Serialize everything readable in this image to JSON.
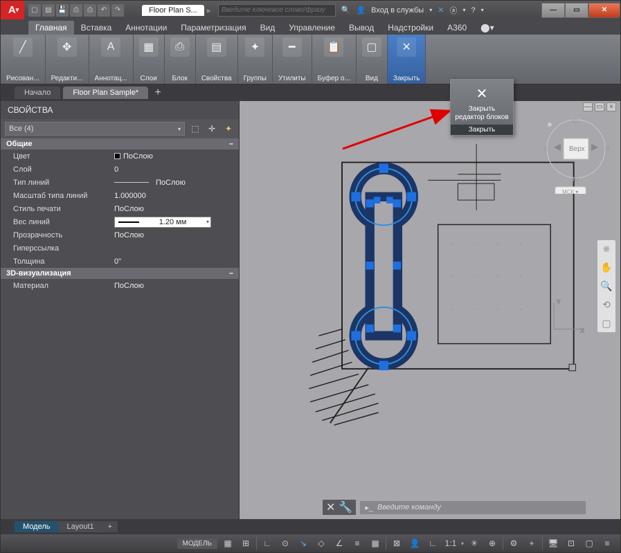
{
  "title": {
    "file": "Floor Plan S...",
    "search_placeholder": "Введите ключевое слово/фразу",
    "login": "Вход в службы"
  },
  "ribbon_tabs": [
    "Главная",
    "Вставка",
    "Аннотации",
    "Параметризация",
    "Вид",
    "Управление",
    "Вывод",
    "Надстройки",
    "A360"
  ],
  "ribbon_panels": [
    {
      "label": "Рисован...",
      "icon": "╱"
    },
    {
      "label": "Редакти...",
      "icon": "✥"
    },
    {
      "label": "Аннотац...",
      "icon": "A"
    },
    {
      "label": "Слои",
      "icon": "▦"
    },
    {
      "label": "Блок",
      "icon": "⎙"
    },
    {
      "label": "Свойства",
      "icon": "▤"
    },
    {
      "label": "Группы",
      "icon": "✦"
    },
    {
      "label": "Утилиты",
      "icon": "━"
    },
    {
      "label": "Буфер о...",
      "icon": "📋"
    },
    {
      "label": "Вид",
      "icon": "▢"
    },
    {
      "label": "Закрыть",
      "icon": "✕",
      "active": true
    }
  ],
  "doctabs": {
    "start": "Начало",
    "active": "Floor Plan Sample*"
  },
  "props_panel": {
    "title": "СВОЙСТВА",
    "selector": "Все (4)",
    "sections": {
      "general": {
        "header": "Общие",
        "rows": [
          {
            "label": "Цвет",
            "value": "ПоСлою",
            "swatch": true
          },
          {
            "label": "Слой",
            "value": "0"
          },
          {
            "label": "Тип линий",
            "value": "ПоСлою",
            "line": true
          },
          {
            "label": "Масштаб типа линий",
            "value": "1.000000"
          },
          {
            "label": "Стиль печати",
            "value": "ПоСлою"
          },
          {
            "label": "Вес линий",
            "value": "1.20 мм",
            "combo": true
          },
          {
            "label": "Прозрачность",
            "value": "ПоСлою"
          },
          {
            "label": "Гиперссылка",
            "value": ""
          },
          {
            "label": "Толщина",
            "value": "0\""
          }
        ]
      },
      "viz3d": {
        "header": "3D-визуализация",
        "rows": [
          {
            "label": "Материал",
            "value": "ПоСлою"
          }
        ]
      }
    }
  },
  "close_dropdown": {
    "line1": "Закрыть",
    "line2": "редактор блоков",
    "bar": "Закрыть"
  },
  "viewcube": {
    "top": "Верх",
    "n": "С",
    "s": "Ю",
    "e": "В",
    "w": "З",
    "ucs": "МСК"
  },
  "cmdline": {
    "prompt": "Введите команду"
  },
  "modeltabs": {
    "model": "Модель",
    "layout": "Layout1"
  },
  "status": {
    "model": "МОДЕЛЬ",
    "scale": "1:1"
  }
}
